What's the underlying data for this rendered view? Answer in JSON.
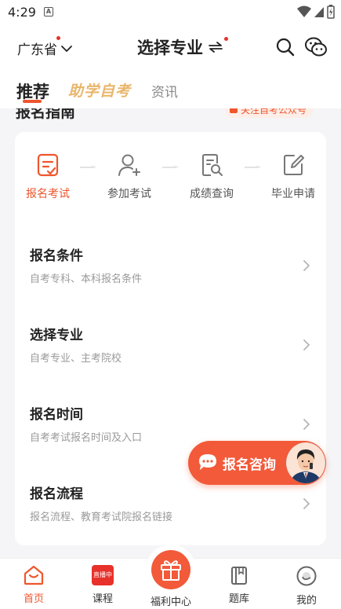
{
  "status_bar": {
    "time": "4:29",
    "a_label": "A"
  },
  "header": {
    "province": "广东省",
    "title": "选择专业"
  },
  "tabs": {
    "recommend": "推荐",
    "zhuxue": "助学自考",
    "news": "资讯"
  },
  "section": {
    "title": "报名指南",
    "follow": "关注自考公众号"
  },
  "steps": [
    {
      "label": "报名考试",
      "icon": "register-icon",
      "active": true
    },
    {
      "label": "参加考试",
      "icon": "user-add-icon",
      "active": false
    },
    {
      "label": "成绩查询",
      "icon": "score-search-icon",
      "active": false
    },
    {
      "label": "毕业申请",
      "icon": "edit-icon",
      "active": false
    }
  ],
  "rows": [
    {
      "title": "报名条件",
      "subtitle": "自考专科、本科报名条件"
    },
    {
      "title": "选择专业",
      "subtitle": "自考专业、主考院校"
    },
    {
      "title": "报名时间",
      "subtitle": "自考考试报名时间及入口"
    },
    {
      "title": "报名流程",
      "subtitle": "报名流程、教育考试院报名链接"
    }
  ],
  "consult": {
    "label": "报名咨询"
  },
  "nav": {
    "home": "首页",
    "courses": "课程",
    "courses_badge": "直播中",
    "welfare": "福利中心",
    "questions": "题库",
    "mine": "我的"
  },
  "colors": {
    "accent": "#f0552c",
    "gold": "#e9b66b",
    "red_dot": "#e8312b"
  }
}
